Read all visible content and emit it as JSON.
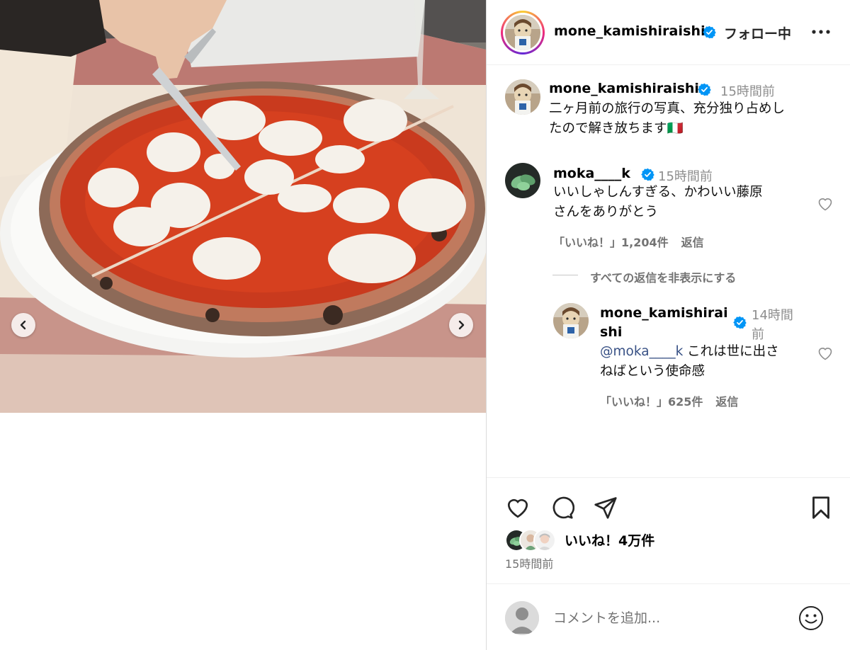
{
  "header": {
    "username": "mone_kamishiraishi",
    "follow_status": "フォロー中",
    "more_icon": "more-horizontal-icon"
  },
  "caption": {
    "username": "mone_kamishiraishi",
    "time": "15時間前",
    "text_line1": "二ヶ月前の旅行の写真、充分独り占めし",
    "text_line2": "たので解き放ちます🇮🇹"
  },
  "comments": [
    {
      "username": "moka____k",
      "time": "15時間前",
      "text_line1": "いいしゃしんすぎる、かわいい藤原",
      "text_line2": "さんをありがとう",
      "likes": "「いいね！」1,204件",
      "reply_label": "返信"
    }
  ],
  "hide_replies": "すべての返信を非表示にする",
  "reply": {
    "username_line1": "mone_kamishirai",
    "username_line2": "shi",
    "time_line1": "14時間",
    "time_line2": "前",
    "mention": "@moka____k",
    "text_line1": " これは世に出さ",
    "text_line2": "ねばという使命感",
    "likes": "「いいね！」625件",
    "reply_label": "返信"
  },
  "actions": {
    "likes_text": "いいね！4万件",
    "post_time": "15時間前"
  },
  "add_comment": {
    "placeholder": "コメントを追加..."
  },
  "colors": {
    "verified": "#0095f6",
    "story_ring": "#ee2a7b",
    "muted_text": "#737373",
    "mention": "#385185"
  }
}
